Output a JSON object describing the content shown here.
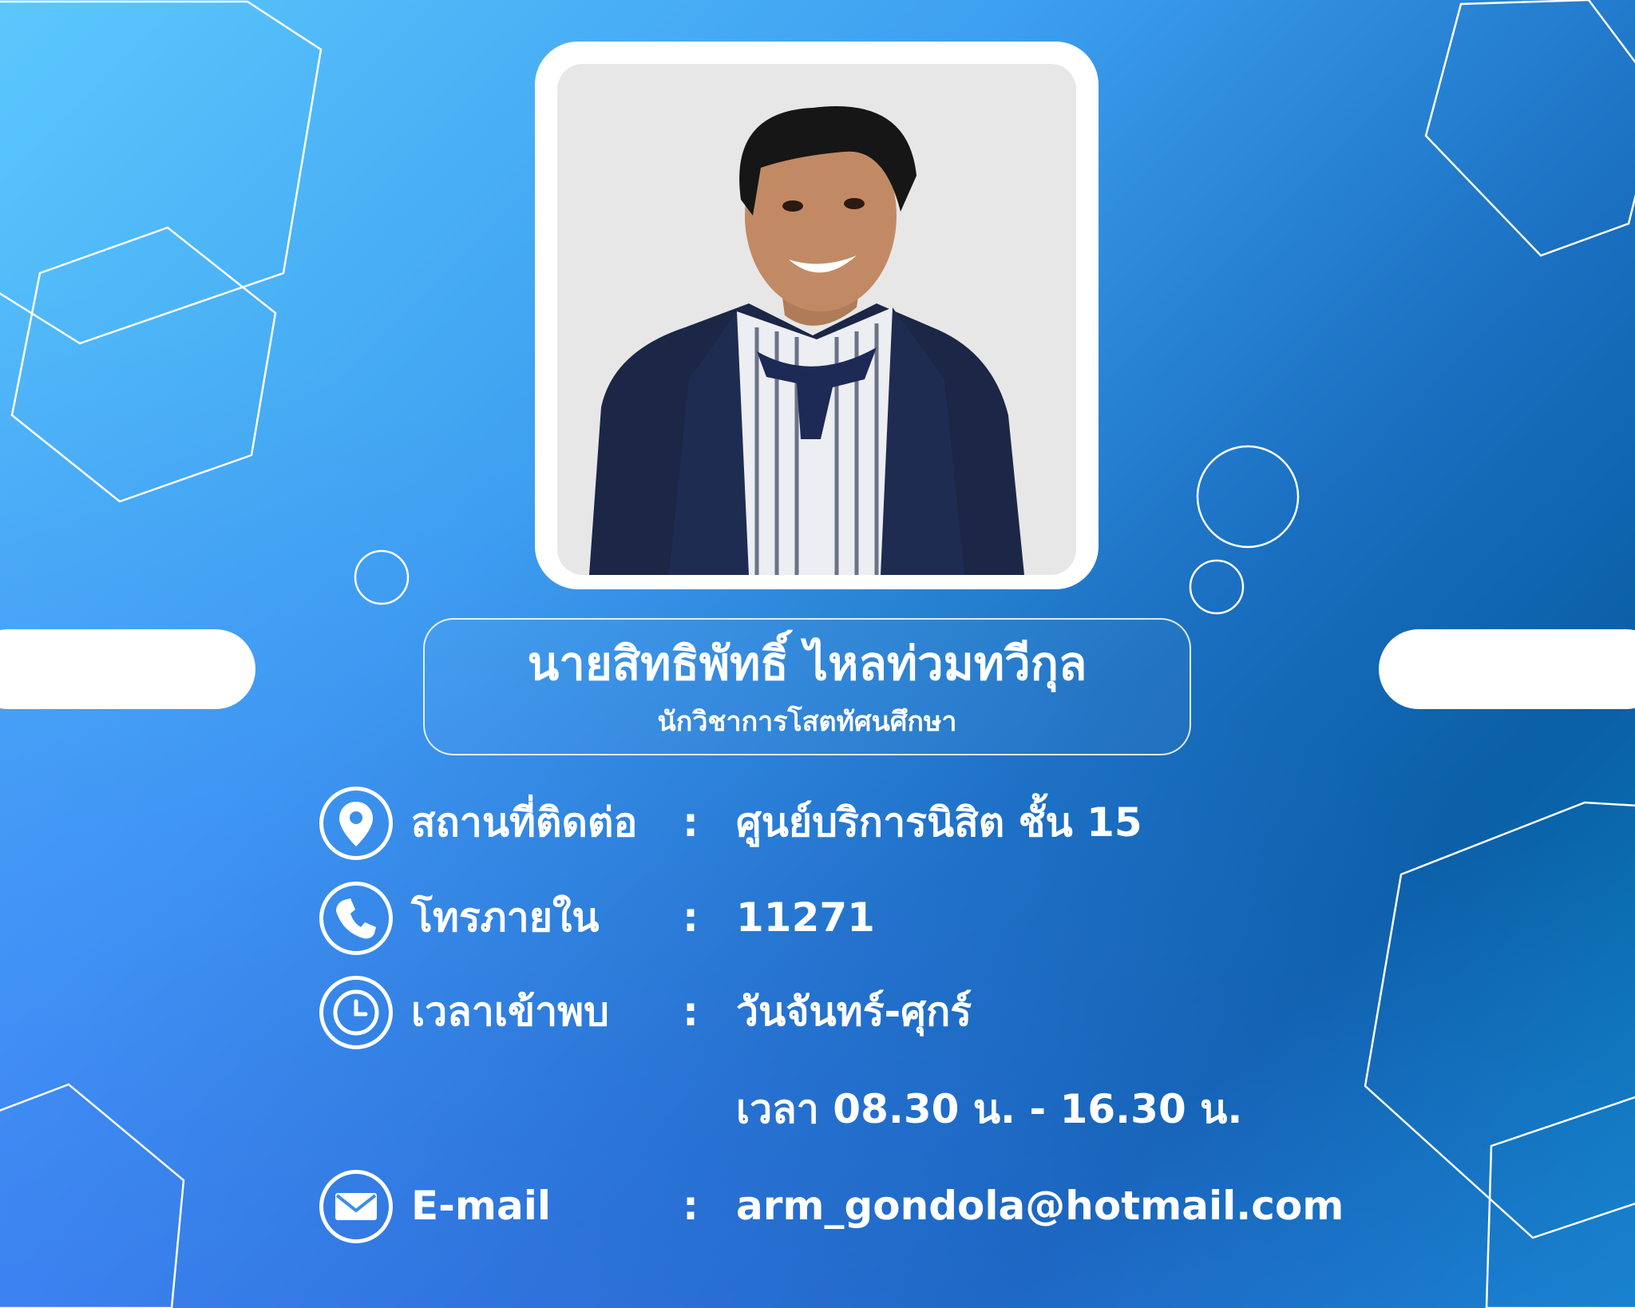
{
  "profile": {
    "name": "นายสิทธิพัทธิ์ ไหลท่วมทวีกุล",
    "title": "นักวิชาการโสตทัศนศึกษา"
  },
  "contact": {
    "location": {
      "icon": "location-pin-icon",
      "label": "สถานที่ติดต่อ",
      "separator": ":",
      "value": "ศูนย์บริการนิสิต ชั้น 15"
    },
    "phone": {
      "icon": "phone-icon",
      "label": "โทรภายใน",
      "separator": ":",
      "value": "11271"
    },
    "hours": {
      "icon": "clock-icon",
      "label": "เวลาเข้าพบ",
      "separator": ":",
      "value": "วันจันทร์-ศุกร์",
      "value_line2": "เวลา 08.30 น. - 16.30 น."
    },
    "email": {
      "icon": "envelope-icon",
      "label": "E-mail",
      "separator": ":",
      "value": "arm_gondola@hotmail.com"
    }
  },
  "colors": {
    "gradient_light": "#5bc8fd",
    "gradient_mid": "#1a6fc0",
    "gradient_dark": "#0a5fa6",
    "gradient_teal": "#0b86c2",
    "foreground": "#ffffff"
  }
}
